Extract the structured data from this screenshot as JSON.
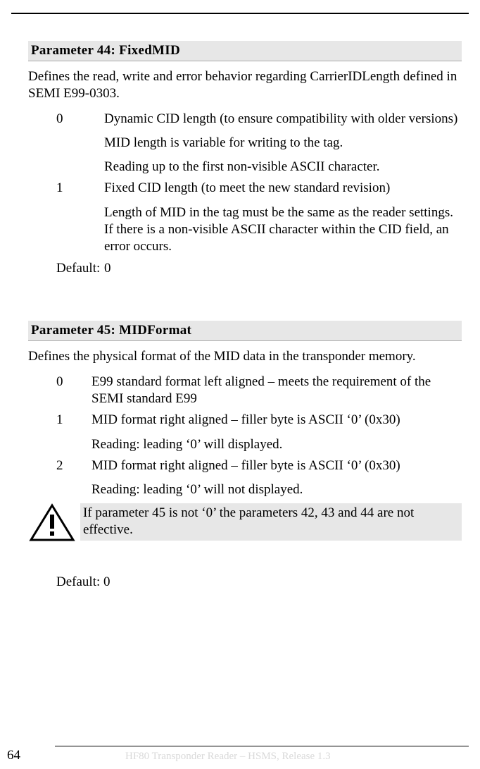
{
  "param44": {
    "header": "Parameter 44: FixedMID",
    "intro": "Defines the read, write and error behavior regarding CarrierIDLength defined in SEMI E99-0303.",
    "row0_key": "0",
    "row0_p1": "Dynamic CID length (to ensure compatibility with older versions)",
    "row0_p2": "MID length is variable for writing to the tag.",
    "row0_p3": "Reading up to the first non-visible ASCII character.",
    "row1_key": "1",
    "row1_p1": "Fixed CID length (to meet the new standard revision)",
    "row1_p2": "Length of MID in the tag must be the same as the reader settings. If there is a non-visible ASCII character within the CID field, an error occurs.",
    "default_key": "Default:",
    "default_val": "0"
  },
  "param45": {
    "header": "Parameter 45:  MIDFormat",
    "intro": "Defines the physical format of the MID data in the transponder memory.",
    "row0_key": "0",
    "row0_p1": "E99 standard format left aligned – meets the requirement of the SEMI standard E99",
    "row1_key": "1",
    "row1_p1": "MID format right aligned – filler byte is ASCII ‘0’ (0x30)",
    "row1_p2": "Reading: leading ‘0’ will displayed.",
    "row2_key": "2",
    "row2_p1": "MID format right aligned – filler byte is ASCII ‘0’ (0x30)",
    "row2_p2": "Reading: leading ‘0’ will not displayed.",
    "warn_text": "If parameter 45 is not ‘0’ the parameters 42, 43 and 44 are not effective.",
    "default_line": "Default: 0"
  },
  "footer": {
    "page_num": "64",
    "footer_text": "HF80 Transponder Reader – HSMS, Release 1.3"
  }
}
